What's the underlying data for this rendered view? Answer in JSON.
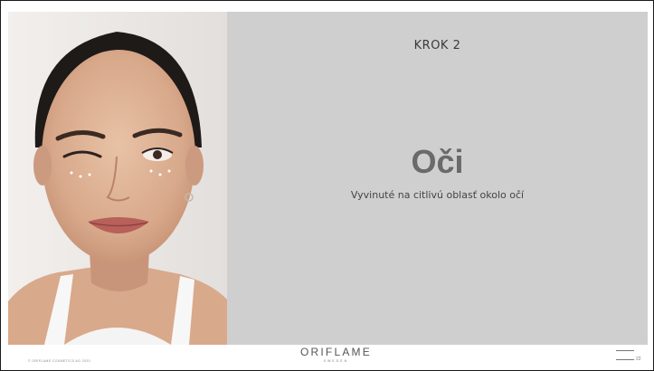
{
  "slide": {
    "step": "KROK 2",
    "title": "Oči",
    "subtitle": "Vyvinuté na citlivú oblasť okolo očí"
  },
  "footer": {
    "copyright": "© ORIFLAME COSMETICS AG 2020",
    "logo_text": "ORIFLAME",
    "logo_sub": "SWEDEN",
    "page_number": "22",
    "menu_icon": "hamburger-icon"
  },
  "colors": {
    "panel_background": "#cfcfcf",
    "title": "#6a6a6a"
  }
}
